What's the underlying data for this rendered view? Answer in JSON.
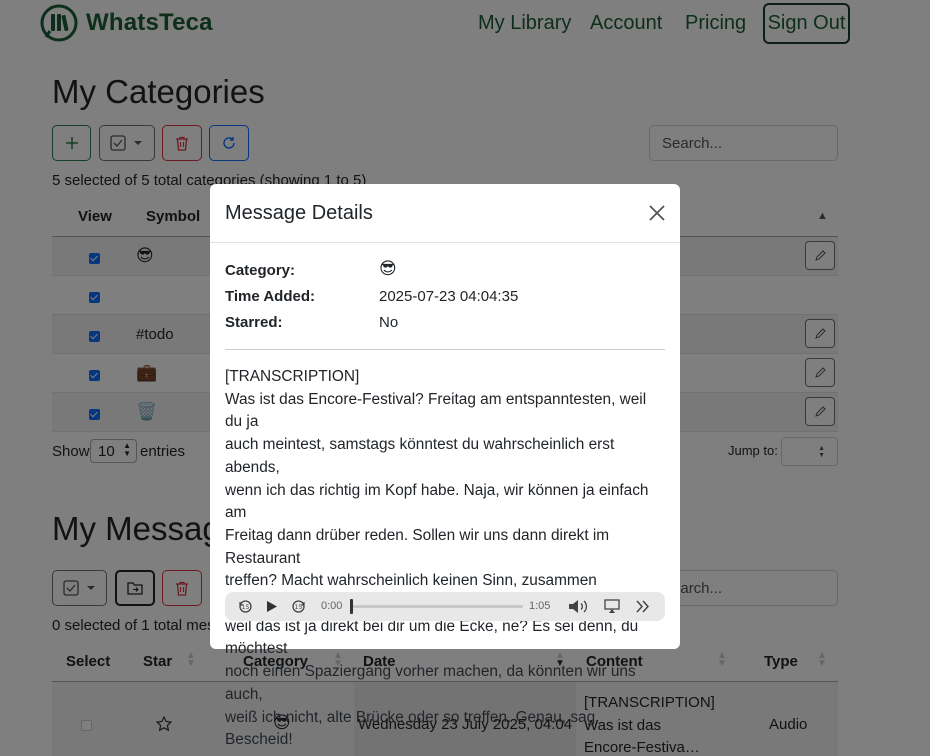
{
  "nav": {
    "brand": "WhatsTeca",
    "links": [
      "My Library",
      "Account",
      "Pricing"
    ],
    "signout": "Sign Out"
  },
  "categories": {
    "title": "My Categories",
    "search_placeholder": "Search...",
    "info": "5 selected of 5 total categories (showing 1 to 5)",
    "columns": [
      "View",
      "Symbol"
    ],
    "rows": [
      {
        "symbol": "😎"
      },
      {
        "symbol": ""
      },
      {
        "symbol": "#todo"
      },
      {
        "symbol": "💼"
      },
      {
        "symbol": "🗑️"
      }
    ],
    "show_label": "Show",
    "page_size": "10",
    "entries_label": "entries",
    "jump_label": "Jump to:"
  },
  "messages": {
    "title": "My Messages",
    "search_placeholder": "Search...",
    "info": "0 selected of 1 total mess",
    "columns": [
      "Select",
      "Star",
      "Category",
      "Date",
      "Content",
      "Type"
    ],
    "row": {
      "category": "😎",
      "date": "Wednesday 23 July 2025, 04:04",
      "content_lines": [
        "[TRANSCRIPTION]",
        "Was ist das",
        "Encore-Festiva…"
      ],
      "type": "Audio"
    }
  },
  "modal": {
    "title": "Message Details",
    "fields": [
      {
        "label": "Category:",
        "value": "😎"
      },
      {
        "label": "Time Added:",
        "value": "2025-07-23 04:04:35"
      },
      {
        "label": "Starred:",
        "value": "No"
      }
    ],
    "transcription_lines": [
      "[TRANSCRIPTION]",
      "Was ist das Encore-Festival? Freitag am entspanntesten, weil du ja",
      "auch meintest, samstags könntest du wahrscheinlich erst abends,",
      "wenn ich das richtig im Kopf habe. Naja, wir können ja einfach am",
      "Freitag dann drüber reden. Sollen wir uns dann direkt im Restaurant",
      "treffen? Macht wahrscheinlich keinen Sinn, zusammen hinzulaufen,",
      "weil das ist ja direkt bei dir um die Ecke, ne? Es sei denn, du möchtest",
      "noch einen Spaziergang vorher machen, da könnten wir uns auch,",
      "weiß ich nicht, alte Brücke oder so treffen. Genau, sag Bescheid!"
    ],
    "audio": {
      "current": "0:00",
      "duration": "1:05",
      "progress": 0
    }
  },
  "colors": {
    "brand": "#1a5c36",
    "primary": "#0d6efd",
    "danger": "#dc3545"
  }
}
